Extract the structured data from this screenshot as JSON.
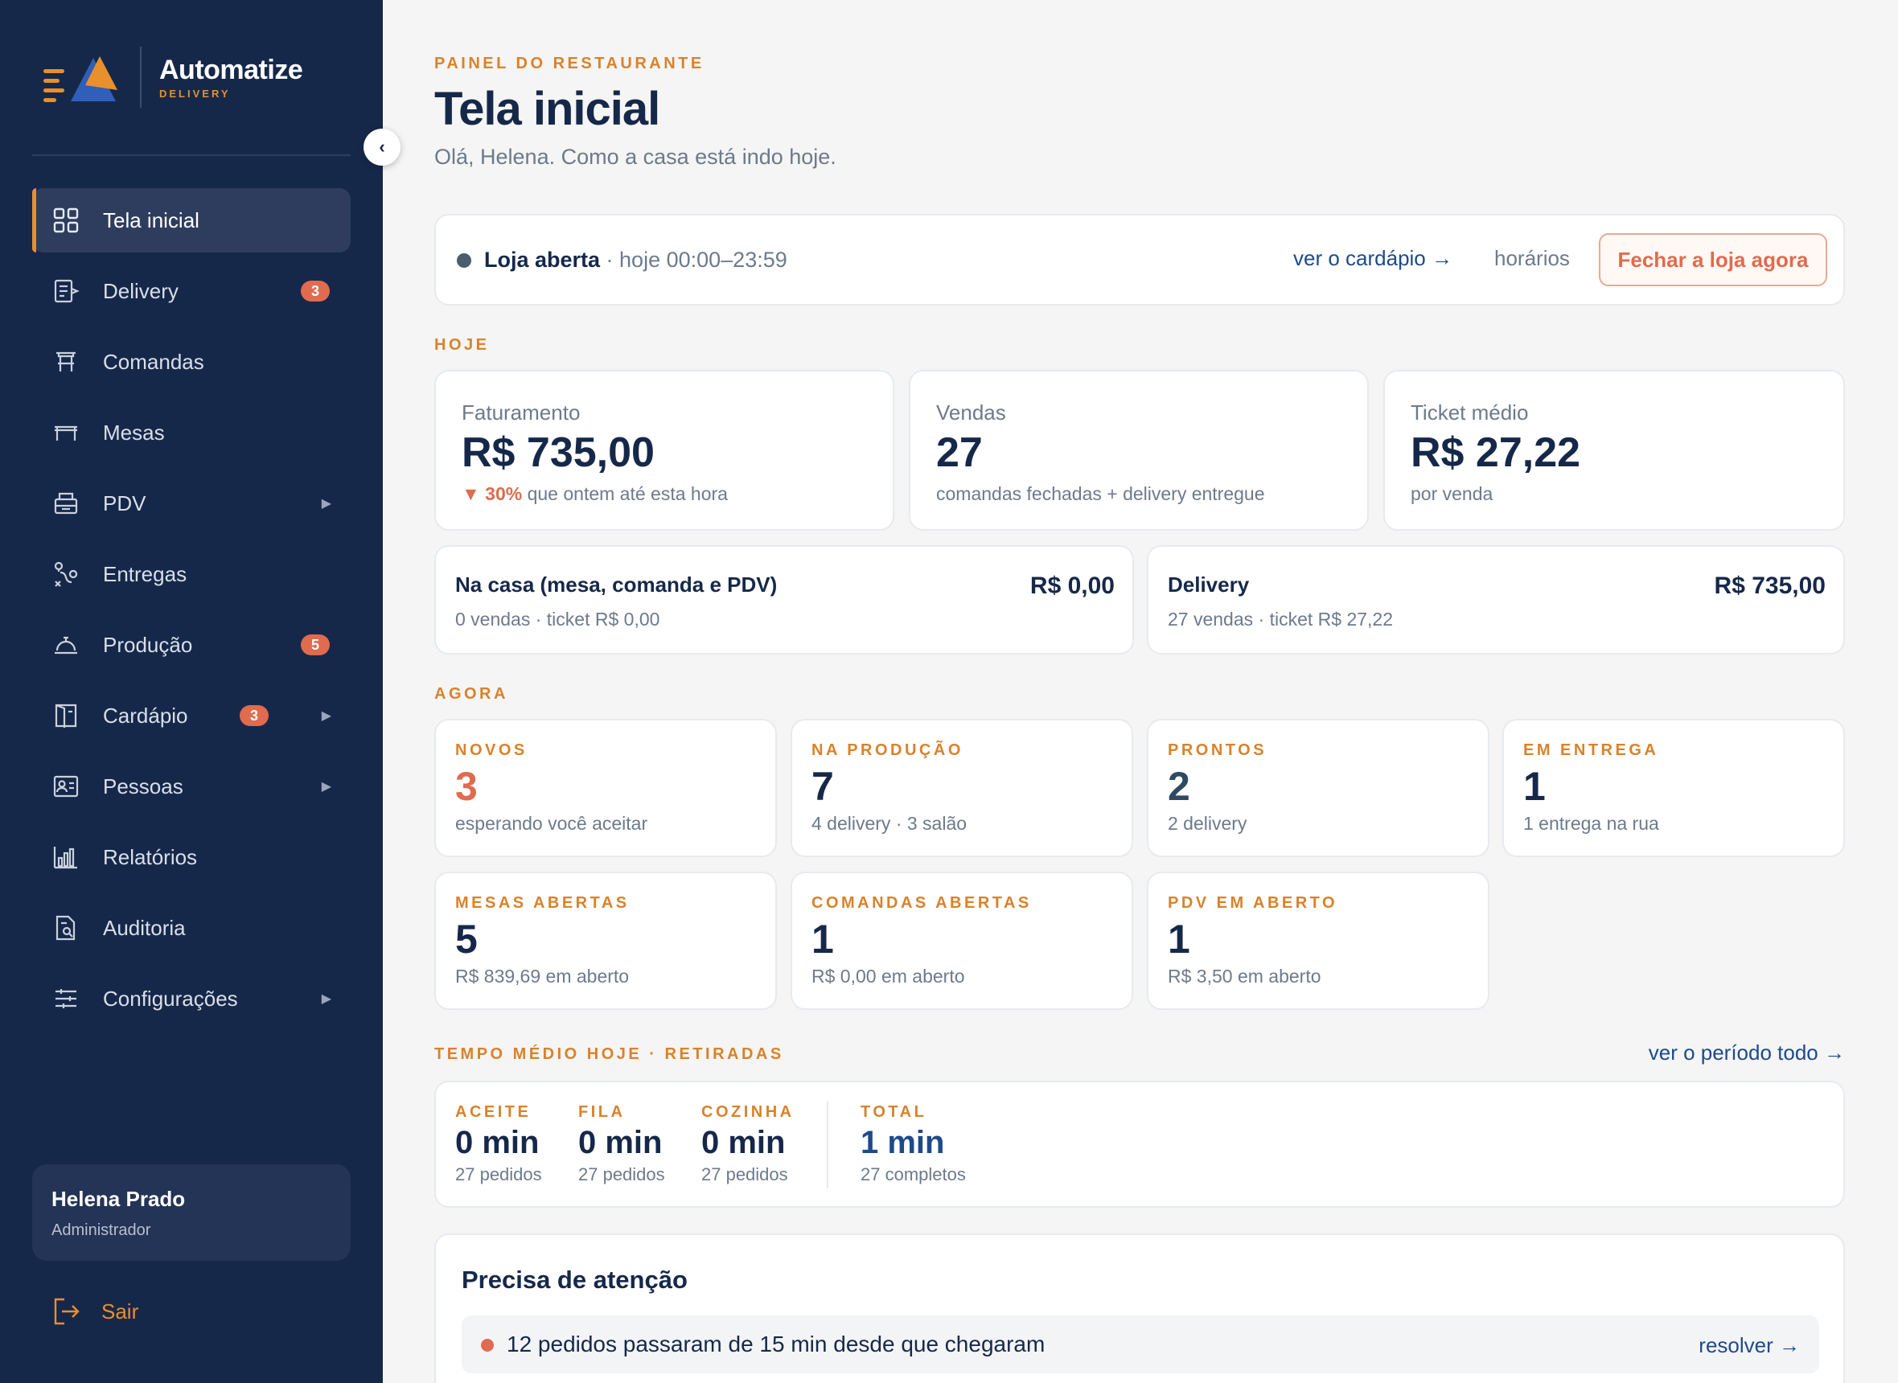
{
  "brand": {
    "name": "Automatize",
    "sub": "DELIVERY"
  },
  "sidebar": {
    "collapse_icon": "‹",
    "items": [
      {
        "label": "Tela inicial",
        "icon": "grid-icon",
        "active": true
      },
      {
        "label": "Delivery",
        "icon": "delivery-icon",
        "badge": "3"
      },
      {
        "label": "Comandas",
        "icon": "comandas-icon"
      },
      {
        "label": "Mesas",
        "icon": "table-icon"
      },
      {
        "label": "PDV",
        "icon": "pos-icon",
        "arrow": "▶"
      },
      {
        "label": "Entregas",
        "icon": "route-icon"
      },
      {
        "label": "Produção",
        "icon": "cloche-icon",
        "badge": "5"
      },
      {
        "label": "Cardápio",
        "icon": "menu-book-icon",
        "badge": "3",
        "arrow": "▶"
      },
      {
        "label": "Pessoas",
        "icon": "id-card-icon",
        "arrow": "▶"
      },
      {
        "label": "Relatórios",
        "icon": "bar-chart-icon"
      },
      {
        "label": "Auditoria",
        "icon": "audit-icon"
      },
      {
        "label": "Configurações",
        "icon": "sliders-icon",
        "arrow": "▶"
      }
    ],
    "user": {
      "name": "Helena Prado",
      "role": "Administrador"
    },
    "logout_label": "Sair"
  },
  "header": {
    "eyebrow": "PAINEL DO RESTAURANTE",
    "title": "Tela inicial",
    "subtitle": "Olá, Helena. Como a casa está indo hoje."
  },
  "store": {
    "status": "Loja aberta",
    "hours": " · hoje 00:00–23:59",
    "menu_link": "ver o cardápio →",
    "hours_link": "horários",
    "close_button": "Fechar a loja agora"
  },
  "today": {
    "label": "HOJE",
    "kpis": [
      {
        "label": "Faturamento",
        "value": "R$ 735,00",
        "delta": "▼ 30%",
        "note": " que ontem até esta hora"
      },
      {
        "label": "Vendas",
        "value": "27",
        "note": "comandas fechadas + delivery entregue"
      },
      {
        "label": "Ticket médio",
        "value": "R$ 27,22",
        "note": "por venda"
      }
    ],
    "split": [
      {
        "title": "Na casa (mesa, comanda e PDV)",
        "sub": "0 vendas · ticket R$ 0,00",
        "value": "R$ 0,00"
      },
      {
        "title": "Delivery",
        "sub": "27 vendas · ticket R$ 27,22",
        "value": "R$ 735,00"
      }
    ]
  },
  "now": {
    "label": "AGORA",
    "cards": [
      {
        "label": "NOVOS",
        "value": "3",
        "sub": "esperando você aceitar"
      },
      {
        "label": "NA PRODUÇÃO",
        "value": "7",
        "sub": "4 delivery · 3 salão"
      },
      {
        "label": "PRONTOS",
        "value": "2",
        "sub": "2 delivery"
      },
      {
        "label": "EM ENTREGA",
        "value": "1",
        "sub": "1 entrega na rua"
      },
      {
        "label": "MESAS ABERTAS",
        "value": "5",
        "sub": "R$ 839,69 em aberto"
      },
      {
        "label": "COMANDAS ABERTAS",
        "value": "1",
        "sub": "R$ 0,00 em aberto"
      },
      {
        "label": "PDV EM ABERTO",
        "value": "1",
        "sub": "R$ 3,50 em aberto"
      }
    ]
  },
  "times": {
    "label": "TEMPO MÉDIO HOJE · RETIRADAS",
    "link": "ver o período todo →",
    "cols": [
      {
        "label": "ACEITE",
        "value": "0 min",
        "sub": "27 pedidos"
      },
      {
        "label": "FILA",
        "value": "0 min",
        "sub": "27 pedidos"
      },
      {
        "label": "COZINHA",
        "value": "0 min",
        "sub": "27 pedidos"
      },
      {
        "label": "TOTAL",
        "value": "1 min",
        "sub": "27 completos"
      }
    ]
  },
  "attention": {
    "title": "Precisa de atenção",
    "items": [
      {
        "text": "12 pedidos passaram de 15 min desde que chegaram",
        "link": "resolver →"
      }
    ]
  },
  "colors": {
    "sidebar": "#16284a",
    "accent": "#e8902c",
    "alert": "#e06b4f",
    "link": "#1d4a8c"
  }
}
